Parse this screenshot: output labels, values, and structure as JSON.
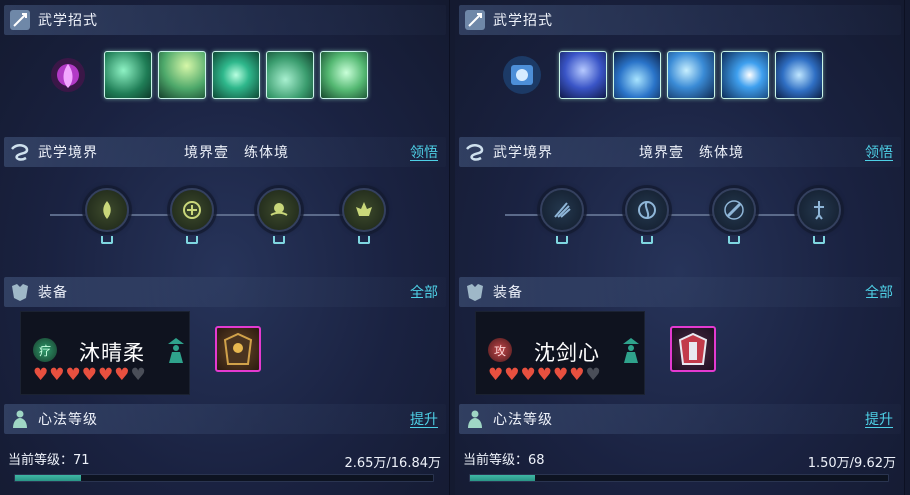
{
  "panels": [
    {
      "martial_moves": {
        "title": "武学招式"
      },
      "realm": {
        "title": "武学境界",
        "level": "境界壹",
        "stage": "练体境",
        "action": "领悟"
      },
      "equipment": {
        "title": "装备",
        "action": "全部",
        "character_name": "沐晴柔",
        "role_badge": "疗",
        "hearts_filled": 6,
        "hearts_total": 7
      },
      "mind_method": {
        "title": "心法等级",
        "action": "提升",
        "level_label": "当前等级：71",
        "exp_text": "2.65万/16.84万",
        "progress": 0.157
      },
      "colors": {
        "accent": "#4ed0e6",
        "skill_theme": "#2fa36a",
        "badge": "#2f9a6b"
      }
    },
    {
      "martial_moves": {
        "title": "武学招式"
      },
      "realm": {
        "title": "武学境界",
        "level": "境界壹",
        "stage": "练体境",
        "action": "领悟"
      },
      "equipment": {
        "title": "装备",
        "action": "全部",
        "character_name": "沈剑心",
        "role_badge": "攻",
        "hearts_filled": 6,
        "hearts_total": 7
      },
      "mind_method": {
        "title": "心法等级",
        "action": "提升",
        "level_label": "当前等级：68",
        "exp_text": "1.50万/9.62万",
        "progress": 0.156
      },
      "colors": {
        "accent": "#4ed0e6",
        "skill_theme": "#2a63c9",
        "badge": "#c2474a"
      }
    }
  ]
}
